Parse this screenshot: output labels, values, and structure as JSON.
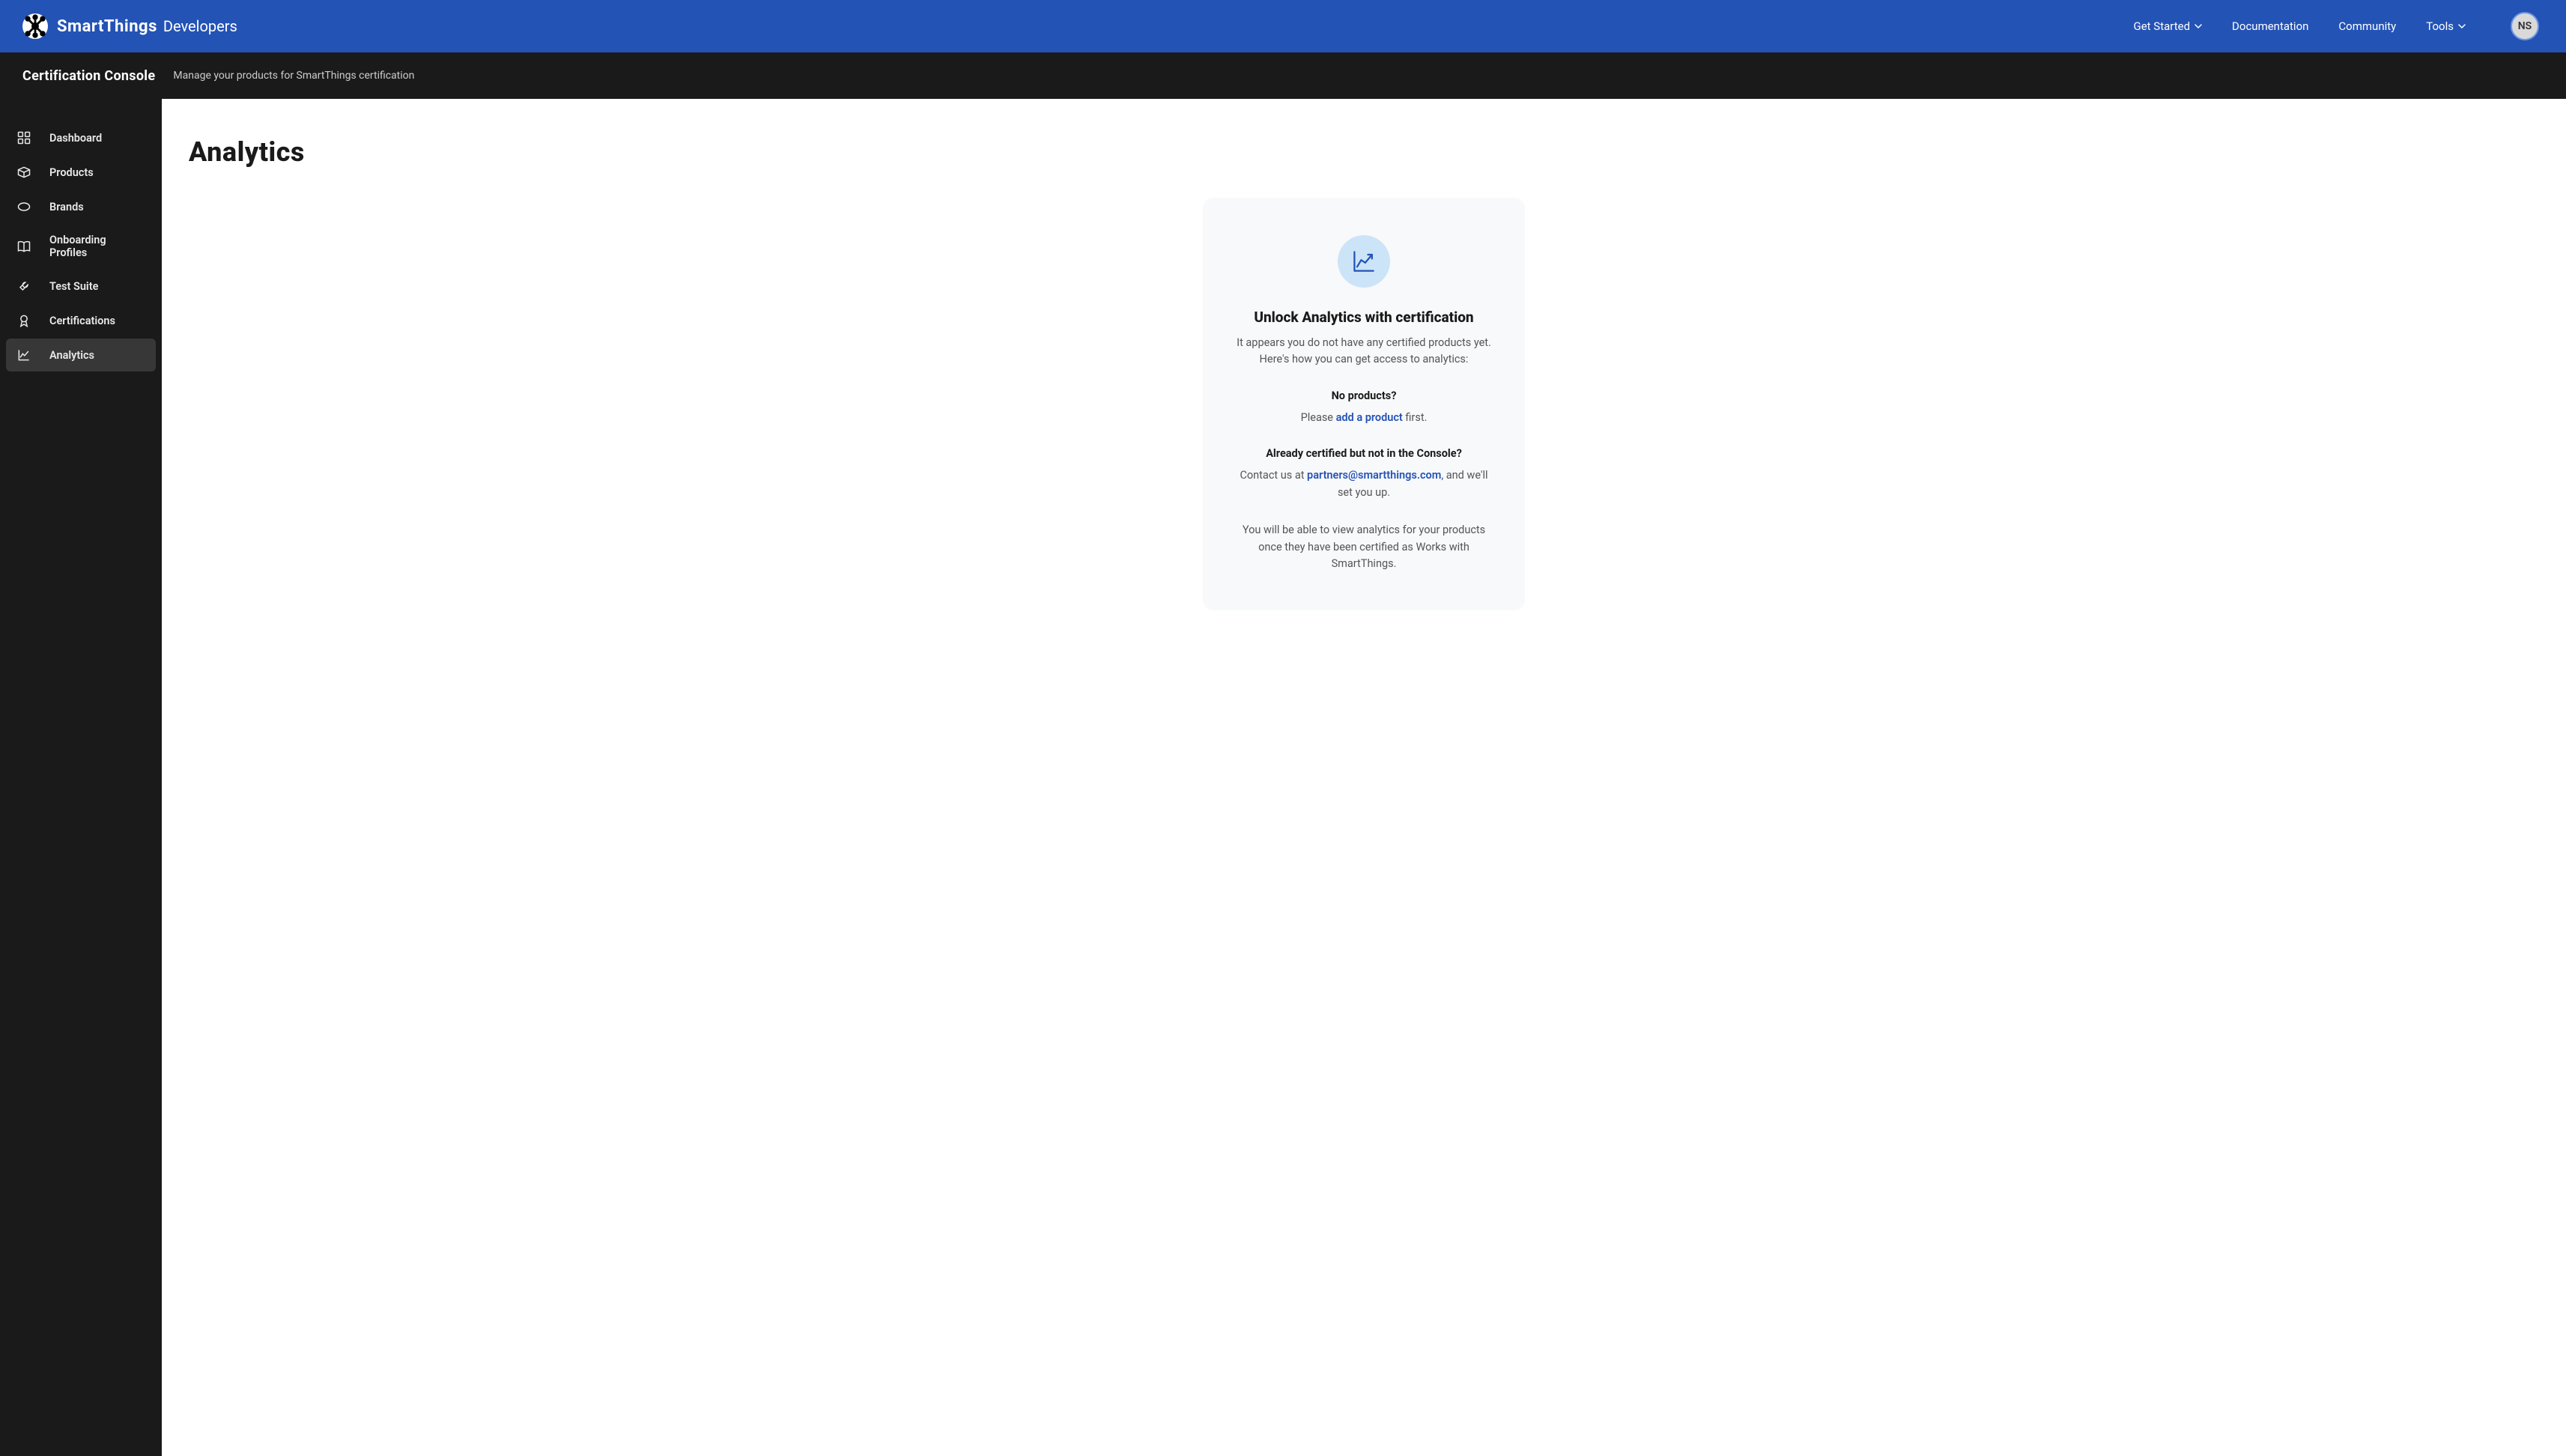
{
  "header": {
    "brand_name": "SmartThings",
    "brand_sub": "Developers",
    "nav": {
      "get_started": "Get Started",
      "documentation": "Documentation",
      "community": "Community",
      "tools": "Tools"
    },
    "avatar_initials": "NS"
  },
  "sub_header": {
    "title": "Certification Console",
    "desc": "Manage your products for SmartThings certification"
  },
  "sidebar": {
    "items": [
      {
        "label": "Dashboard"
      },
      {
        "label": "Products"
      },
      {
        "label": "Brands"
      },
      {
        "label": "Onboarding Profiles"
      },
      {
        "label": "Test Suite"
      },
      {
        "label": "Certifications"
      },
      {
        "label": "Analytics"
      }
    ]
  },
  "main": {
    "page_title": "Analytics",
    "card": {
      "title": "Unlock Analytics with certification",
      "intro": "It appears you do not have any certified products yet. Here's how you can get access to analytics:",
      "no_products_heading": "No products?",
      "no_products_prefix": "Please ",
      "no_products_link": "add a product",
      "no_products_suffix": " first.",
      "already_heading": "Already certified but not in the Console?",
      "contact_prefix": "Contact us at ",
      "contact_email": "partners@smartthings.com",
      "contact_suffix": ", and we'll set you up.",
      "footer": "You will be able to view analytics for your products once they have been certified as Works with SmartThings."
    }
  }
}
